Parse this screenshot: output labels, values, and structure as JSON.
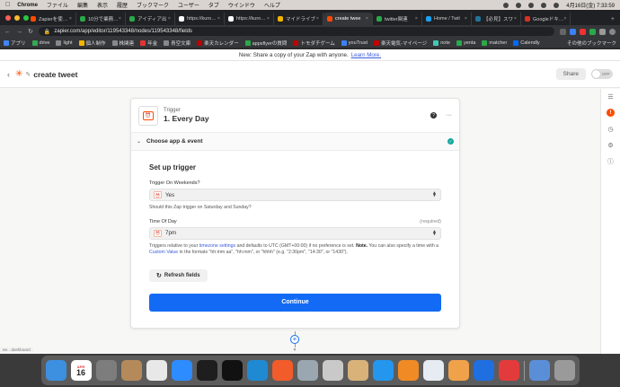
{
  "menubar": {
    "app": "Chrome",
    "items": [
      "ファイル",
      "編集",
      "表示",
      "履歴",
      "ブックマーク",
      "ユーザー",
      "タブ",
      "ウインドウ",
      "ヘルプ"
    ],
    "datetime": "4月16日(金)  7:33:59"
  },
  "tabs": [
    {
      "title": "Zapierを使…",
      "color": "#ff4a00",
      "active": false
    },
    {
      "title": "10分で業務…",
      "color": "#2aa84a",
      "active": false
    },
    {
      "title": "アイディア出",
      "color": "#2aa84a",
      "active": false
    },
    {
      "title": "https://kuro…",
      "color": "#ffffff",
      "active": false
    },
    {
      "title": "https://kuro…",
      "color": "#ffffff",
      "active": false
    },
    {
      "title": "マイドライブ",
      "color": "#f4b400",
      "active": false
    },
    {
      "title": "create twee",
      "color": "#ff4a00",
      "active": true
    },
    {
      "title": "twitter関連",
      "color": "#2aa84a",
      "active": false
    },
    {
      "title": "Home / Twit",
      "color": "#1da1f2",
      "active": false
    },
    {
      "title": "【必見】スワ",
      "color": "#21759b",
      "active": false
    },
    {
      "title": "Googleドキ…",
      "color": "#d93025",
      "active": false
    }
  ],
  "address": {
    "url": "zapier.com/app/editor/119543348/nodes/119543348/fields"
  },
  "bookmarks": [
    {
      "label": "アプリ",
      "color": "#4285f4"
    },
    {
      "label": "drive",
      "color": "#34a853"
    },
    {
      "label": "light",
      "color": "#888888"
    },
    {
      "label": "個人制作",
      "color": "#f4b400"
    },
    {
      "label": "株関連",
      "color": "#888888"
    },
    {
      "label": "年金",
      "color": "#e33333"
    },
    {
      "label": "青空文庫",
      "color": "#888888"
    },
    {
      "label": "楽天カレンダー",
      "color": "#bf0000"
    },
    {
      "label": "appsflyerの質問",
      "color": "#2aa84a"
    },
    {
      "label": "トモダチゲーム",
      "color": "#bf0000"
    },
    {
      "label": "youTrust",
      "color": "#3b82f6"
    },
    {
      "label": "楽天電気-マイページ",
      "color": "#bf0000"
    },
    {
      "label": "note",
      "color": "#41c9b4"
    },
    {
      "label": "yenta",
      "color": "#2aa84a"
    },
    {
      "label": "matcher",
      "color": "#2aa84a"
    },
    {
      "label": "Calendly",
      "color": "#006bff"
    }
  ],
  "bookmarks_other": "その他のブックマーク",
  "banner": {
    "text": "New: Share a copy of your Zap with anyone.",
    "link": "Learn More."
  },
  "header": {
    "zap_name": "create tweet",
    "share_label": "Share",
    "toggle_label": "OFF"
  },
  "step": {
    "type_label": "Trigger",
    "title": "1. Every Day",
    "section": "Choose app & event"
  },
  "setup": {
    "heading": "Set up trigger",
    "field1": {
      "label": "Trigger On Weekends?",
      "value": "Yes",
      "hint": "Should this Zap trigger on Saturday and Sunday?"
    },
    "field2": {
      "label": "Time Of Day",
      "required": "(required)",
      "value": "7pm",
      "hint_a": "Triggers relative to your",
      "hint_link1": "timezone settings",
      "hint_b": "and defaults to UTC (GMT+00:00) if no preference is set.",
      "hint_note": "Note.",
      "hint_c": "You can also specify a time with a",
      "hint_link2": "Custom Value",
      "hint_d": "in the formats \"hh:mm aa\", \"hh:mm\", or \"hhhh\" (e.g. \"2:30pm\", \"14:30\", or \"1430\")."
    },
    "refresh_label": "Refresh fields",
    "continue_label": "Continue"
  },
  "status_url": "ee…dashboard",
  "dock": [
    {
      "name": "finder",
      "color": "#3d8fe0"
    },
    {
      "name": "calendar",
      "color": "#ffffff"
    },
    {
      "name": "system-preferences",
      "color": "#7d7d7d"
    },
    {
      "name": "contacts",
      "color": "#b58a5a"
    },
    {
      "name": "chrome",
      "color": "#e8e8e8"
    },
    {
      "name": "zoom",
      "color": "#2d8cff"
    },
    {
      "name": "terminal",
      "color": "#1e1e1e"
    },
    {
      "name": "iterm",
      "color": "#111111"
    },
    {
      "name": "vscode",
      "color": "#1f8ad2"
    },
    {
      "name": "safari",
      "color": "#f25c2a"
    },
    {
      "name": "quicktime",
      "color": "#9aa7b0"
    },
    {
      "name": "stacks",
      "color": "#c9c9c9"
    },
    {
      "name": "sequel",
      "color": "#d9b27a"
    },
    {
      "name": "docker",
      "color": "#2496ed"
    },
    {
      "name": "git-tower",
      "color": "#f08a24"
    },
    {
      "name": "proxyman",
      "color": "#e6ecf2"
    },
    {
      "name": "preview",
      "color": "#f0a24b"
    },
    {
      "name": "infinity",
      "color": "#1f6fe0"
    },
    {
      "name": "clock",
      "color": "#e33b3b"
    },
    {
      "name": "downloads",
      "color": "#5a8fd8"
    },
    {
      "name": "trash",
      "color": "#9a9a9a"
    }
  ]
}
